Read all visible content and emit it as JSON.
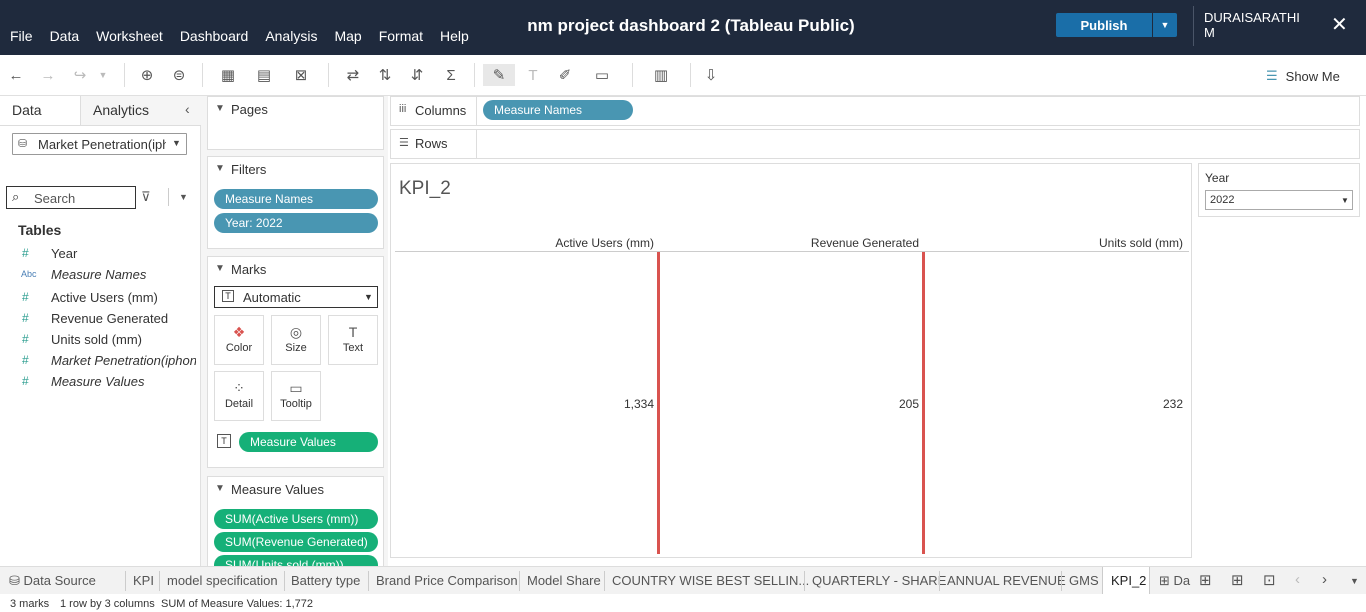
{
  "window": {
    "title": "nm project dashboard 2 (Tableau Public)",
    "menu": [
      "File",
      "Data",
      "Worksheet",
      "Dashboard",
      "Analysis",
      "Map",
      "Format",
      "Help"
    ],
    "publish_label": "Publish",
    "user": "DURAISARATHI\nM",
    "user_line1": "DURAISARATHI",
    "user_line2": "M"
  },
  "toolbar": {
    "show_me_label": "Show Me"
  },
  "left_panel": {
    "tab_data": "Data",
    "tab_analytics": "Analytics",
    "datasource": "Market Penetration(iphone)",
    "search_placeholder": "Search",
    "tables_label": "Tables",
    "fields": [
      {
        "name": "Year",
        "type": "measure",
        "italic": false
      },
      {
        "name": "Measure Names",
        "type": "dimension",
        "italic": true
      },
      {
        "name": "Active Users (mm)",
        "type": "measure",
        "italic": false
      },
      {
        "name": "Revenue Generated",
        "type": "measure",
        "italic": false
      },
      {
        "name": "Units sold (mm)",
        "type": "measure",
        "italic": false
      },
      {
        "name": "Market Penetration(iphone)",
        "type": "measure",
        "italic": true
      },
      {
        "name": "Measure Values",
        "type": "measure",
        "italic": true
      }
    ],
    "field_icon_measure": "#",
    "field_icon_dimension": "Abc"
  },
  "shelves": {
    "pages_label": "Pages",
    "filters_label": "Filters",
    "filters": [
      "Measure Names",
      "Year: 2022"
    ],
    "marks_label": "Marks",
    "mark_type": "Automatic",
    "mark_buttons": [
      "Color",
      "Size",
      "Text",
      "Detail",
      "Tooltip"
    ],
    "marks_pill": "Measure Values",
    "measure_values_label": "Measure Values",
    "measure_values": [
      "SUM(Active Users (mm))",
      "SUM(Revenue Generated)",
      "SUM(Units sold (mm))"
    ]
  },
  "columns_shelf": {
    "label": "Columns",
    "pill": "Measure Names"
  },
  "rows_shelf": {
    "label": "Rows"
  },
  "view": {
    "title": "KPI_2",
    "columns": [
      {
        "header": "Active Users (mm)",
        "value": "1,334"
      },
      {
        "header": "Revenue Generated",
        "value": "205"
      },
      {
        "header": "Units sold (mm)",
        "value": "232"
      }
    ],
    "reference_line_color": "#d9534f"
  },
  "year_filter": {
    "label": "Year",
    "value": "2022"
  },
  "sheet_tabs": {
    "data_source": "Data Source",
    "tabs": [
      "KPI",
      "model specification",
      "Battery type",
      "Brand Price Comparison",
      "Model Share",
      "COUNTRY WISE BEST SELLIN...",
      "QUARTERLY - SHARE",
      "ANNUAL REVENUE",
      "GMS",
      "KPI_2",
      "Da"
    ],
    "active": "KPI_2"
  },
  "status": {
    "marks": "3 marks",
    "rows_cols": "1 row by 3 columns",
    "sum": "SUM of Measure Values: 1,772"
  },
  "colors": {
    "titlebar": "#1f2a3d",
    "publish": "#1a6ea8",
    "pill_blue": "#4996b2",
    "pill_green": "#16b078"
  }
}
